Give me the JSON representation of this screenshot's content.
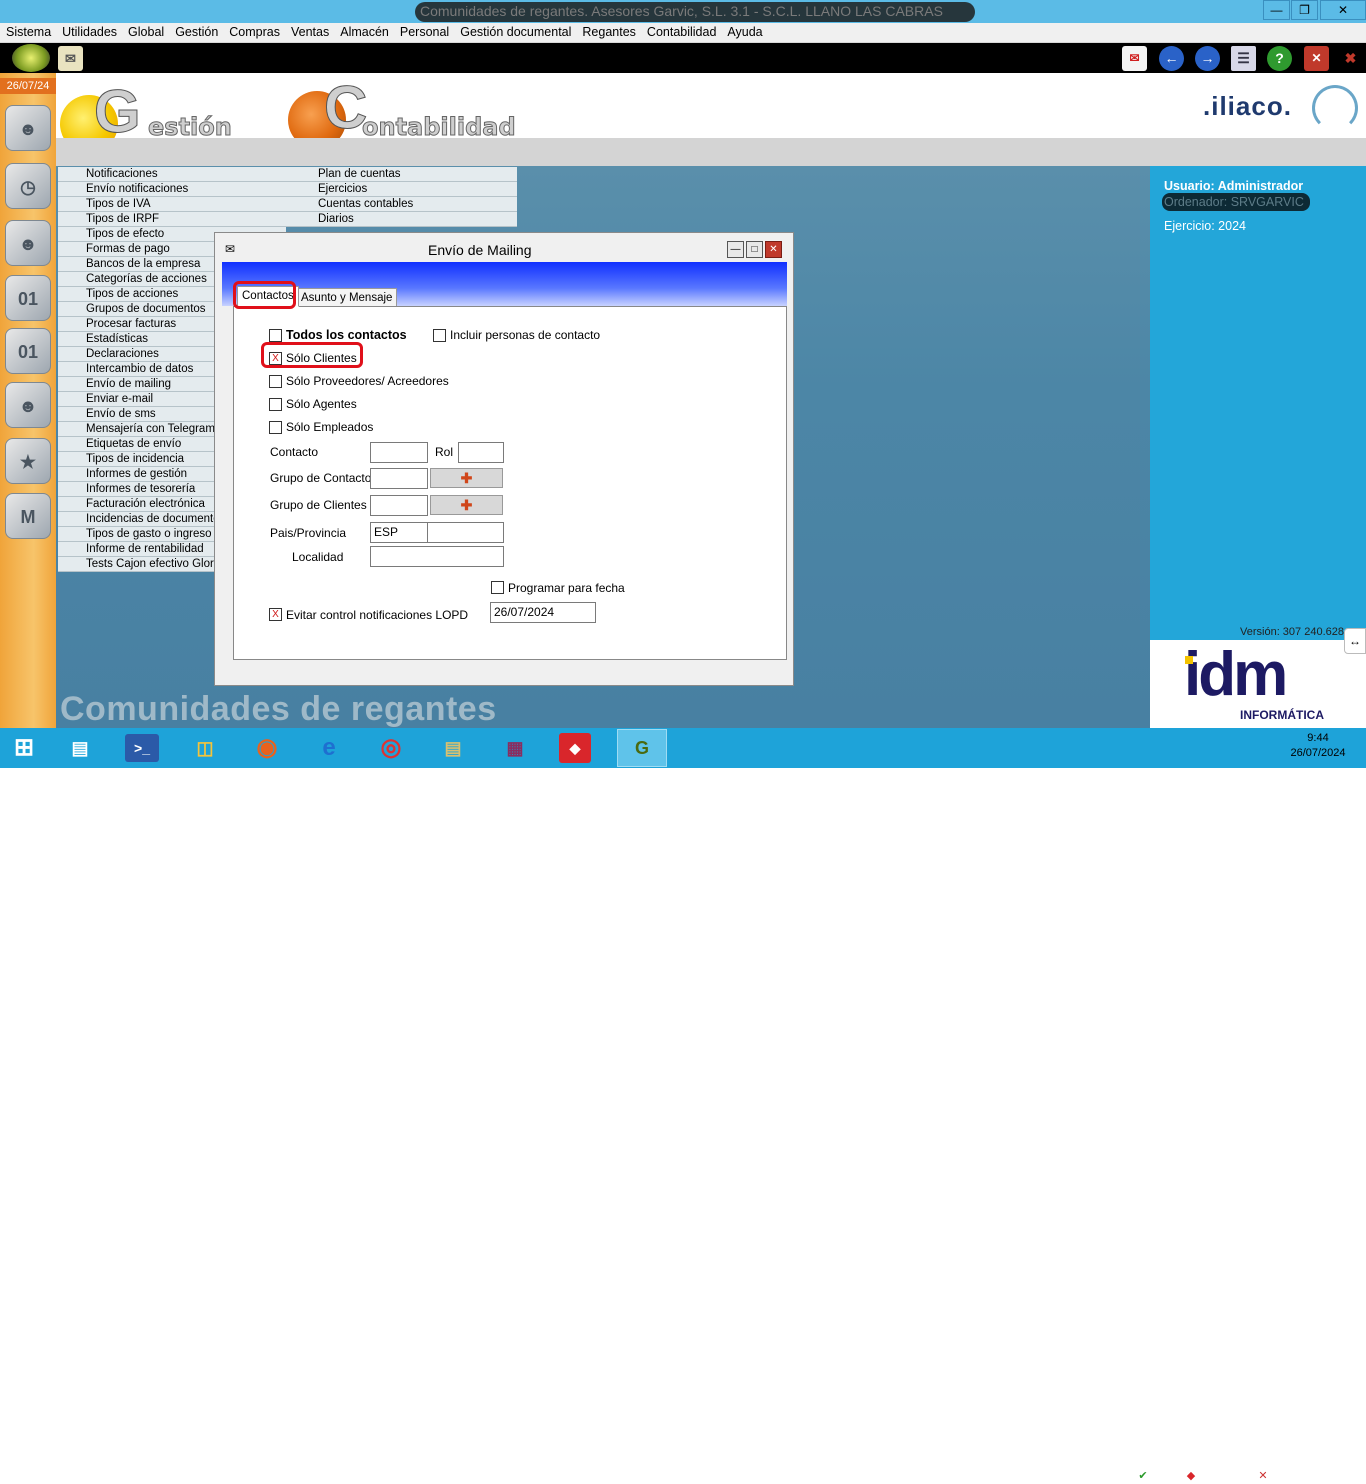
{
  "window": {
    "title": "Comunidades de regantes. Asesores Garvic, S.L. 3.1 - S.C.L. LLANO LAS CABRAS"
  },
  "menubar": [
    "Sistema",
    "Utilidades",
    "Global",
    "Gestión",
    "Compras",
    "Ventas",
    "Almacén",
    "Personal",
    "Gestión documental",
    "Regantes",
    "Contabilidad",
    "Ayuda"
  ],
  "leftbar": {
    "date": "26/07/24"
  },
  "logos": {
    "gestion_letter": "G",
    "gestion_word": "estión",
    "contab_letter": "C",
    "contab_word": "ontabilidad",
    "brand": ".iliaco."
  },
  "menu_col1": [
    "Notificaciones",
    "Envío notificaciones",
    "Tipos de IVA",
    "Tipos de IRPF",
    "Tipos de efecto",
    "Formas de pago",
    "Bancos de la empresa",
    "Categorías de acciones",
    "Tipos de acciones",
    "Grupos de documentos",
    "Procesar facturas",
    "Estadísticas",
    "Declaraciones",
    "Intercambio de datos",
    "Envío de mailing",
    "Enviar e-mail",
    "Envío de sms",
    "Mensajería con Telegram",
    "Etiquetas de envío",
    "Tipos de incidencia",
    "Informes de gestión",
    "Informes de tesorería",
    "Facturación electrónica",
    "Incidencias de documentos",
    "Tipos de gasto o ingreso",
    "Informe de rentabilidad",
    "Tests Cajon efectivo Glory"
  ],
  "menu_col2": [
    "Plan de cuentas",
    "Ejercicios",
    "Cuentas contables",
    "Diarios"
  ],
  "bottom_title": "Comunidades de regantes",
  "rightpanel": {
    "usuario": "Usuario: Administrador",
    "ordenador": "Ordenador: SRVGARVIC",
    "ejercicio": "Ejercicio: 2024",
    "version": "Versión: 307 240.628",
    "idm": "idm",
    "informatica": "INFORMÁTICA"
  },
  "dialog": {
    "title": "Envío de Mailing",
    "tabs": [
      "Contactos",
      "Asunto y Mensaje"
    ],
    "todos": "Todos los contactos",
    "incluir": "Incluir personas de contacto",
    "clientes": "Sólo Clientes",
    "proveedores": "Sólo Proveedores/ Acreedores",
    "agentes": "Sólo Agentes",
    "empleados": "Sólo Empleados",
    "contacto": "Contacto",
    "rol": "Rol",
    "grupo_contactos": "Grupo de Contactos",
    "grupo_clientes": "Grupo de Clientes",
    "pais_provincia": "Pais/Provincia",
    "pais_value": "ESP",
    "localidad": "Localidad",
    "programar": "Programar para fecha",
    "evitar": "Evitar control notificaciones LOPD",
    "fecha_value": "26/07/2024",
    "checked_mark": "X"
  },
  "taskbar": {
    "time": "9:44",
    "date": "26/07/2024"
  }
}
